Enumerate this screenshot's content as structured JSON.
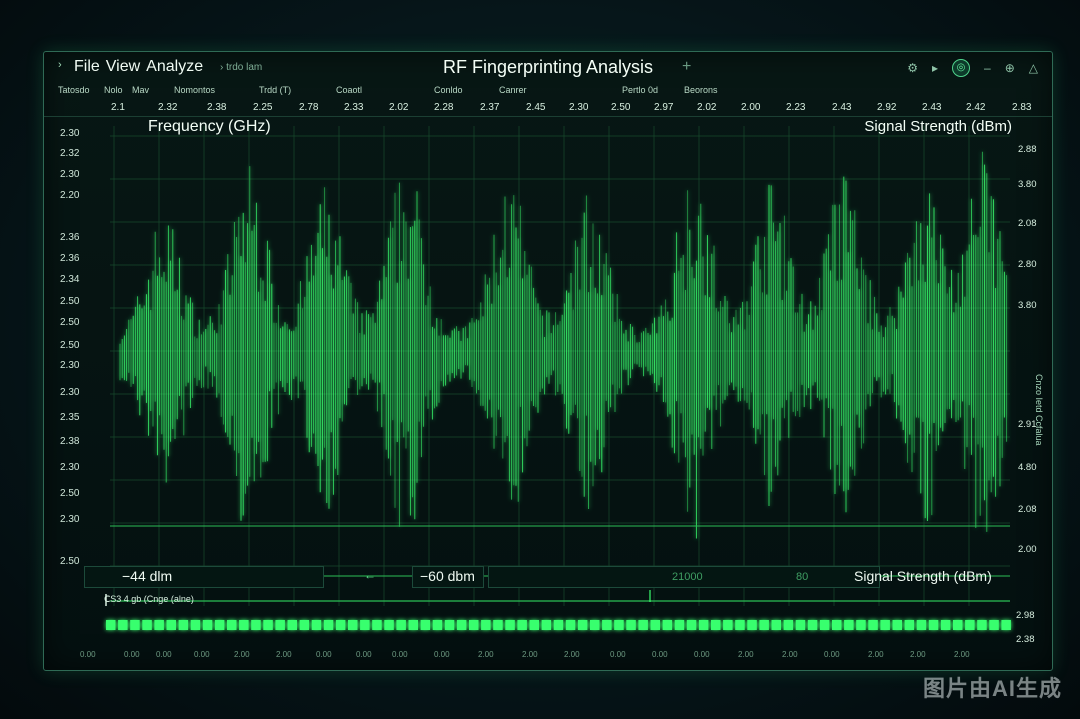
{
  "window": {
    "title": "RF Fingerprinting Analysis",
    "menu": [
      "File",
      "View",
      "Analyze"
    ],
    "crumb": "› trdo lam",
    "title_plus": "+",
    "icons": [
      "settings-icon",
      "play-icon",
      "target-icon",
      "minus-icon",
      "globe-icon",
      "warning-icon"
    ]
  },
  "subbar": [
    "Tatosdo",
    "Nolo",
    "Mav",
    "Nomontos",
    "Trdd (T)",
    "Coaotl",
    "Conldo",
    "Canrer",
    "Pertlo 0d",
    "Beorons"
  ],
  "top_scale": [
    "2.1",
    "2.32",
    "2.38",
    "2.25",
    "2.78",
    "2.33",
    "2.02",
    "2.28",
    "2.37",
    "2.45",
    "2.30",
    "2.50",
    "2.97",
    "2.02",
    "2.00",
    "2.23",
    "2.43",
    "2.92",
    "2.43",
    "2.42",
    "2.83"
  ],
  "left_ticks": [
    "2.30",
    "2.32",
    "2.30",
    "2.20",
    "2.36",
    "2.36",
    "2.34",
    "2.50",
    "2.50",
    "2.50",
    "2.30",
    "2.30",
    "2.35",
    "2.38",
    "2.30",
    "2.50",
    "2.30",
    "2.50"
  ],
  "right_ticks": [
    "2.88",
    "3.80",
    "2.08",
    "2.80",
    "3.80",
    "2.91",
    "4.80",
    "2.08",
    "2.00"
  ],
  "right_vertical_text": "Cnzo Ietd Ccfalua",
  "axis": {
    "left_label": "Frequency (GHz)",
    "right_label": "Signal Strength (dBm)"
  },
  "status": {
    "min_reading": "−44 dlm",
    "arrow": "←",
    "ref_reading": "−60 dbm",
    "center_value": "21000",
    "span_value": "80",
    "label": "Signal Strength (dBm)"
  },
  "mini": {
    "label": "ⅭS3 4 gb   (Cnge (alne)",
    "right_ticks": [
      "2.98",
      "2.38"
    ]
  },
  "bottom_ticks": [
    "0.00",
    "0.00",
    "0.00",
    "0.00",
    "2.00",
    "2.00",
    "0.00",
    "0.00",
    "0.00",
    "0.00",
    "2.00",
    "2.00",
    "2.00",
    "0.00",
    "0.00",
    "0.00",
    "2.00",
    "2.00",
    "0.00",
    "2.00",
    "2.00",
    "2.00"
  ],
  "watermark": "图片由AI生成",
  "colors": {
    "accent": "#39ff6e",
    "grid": "#174a2d",
    "background": "#06161a"
  }
}
